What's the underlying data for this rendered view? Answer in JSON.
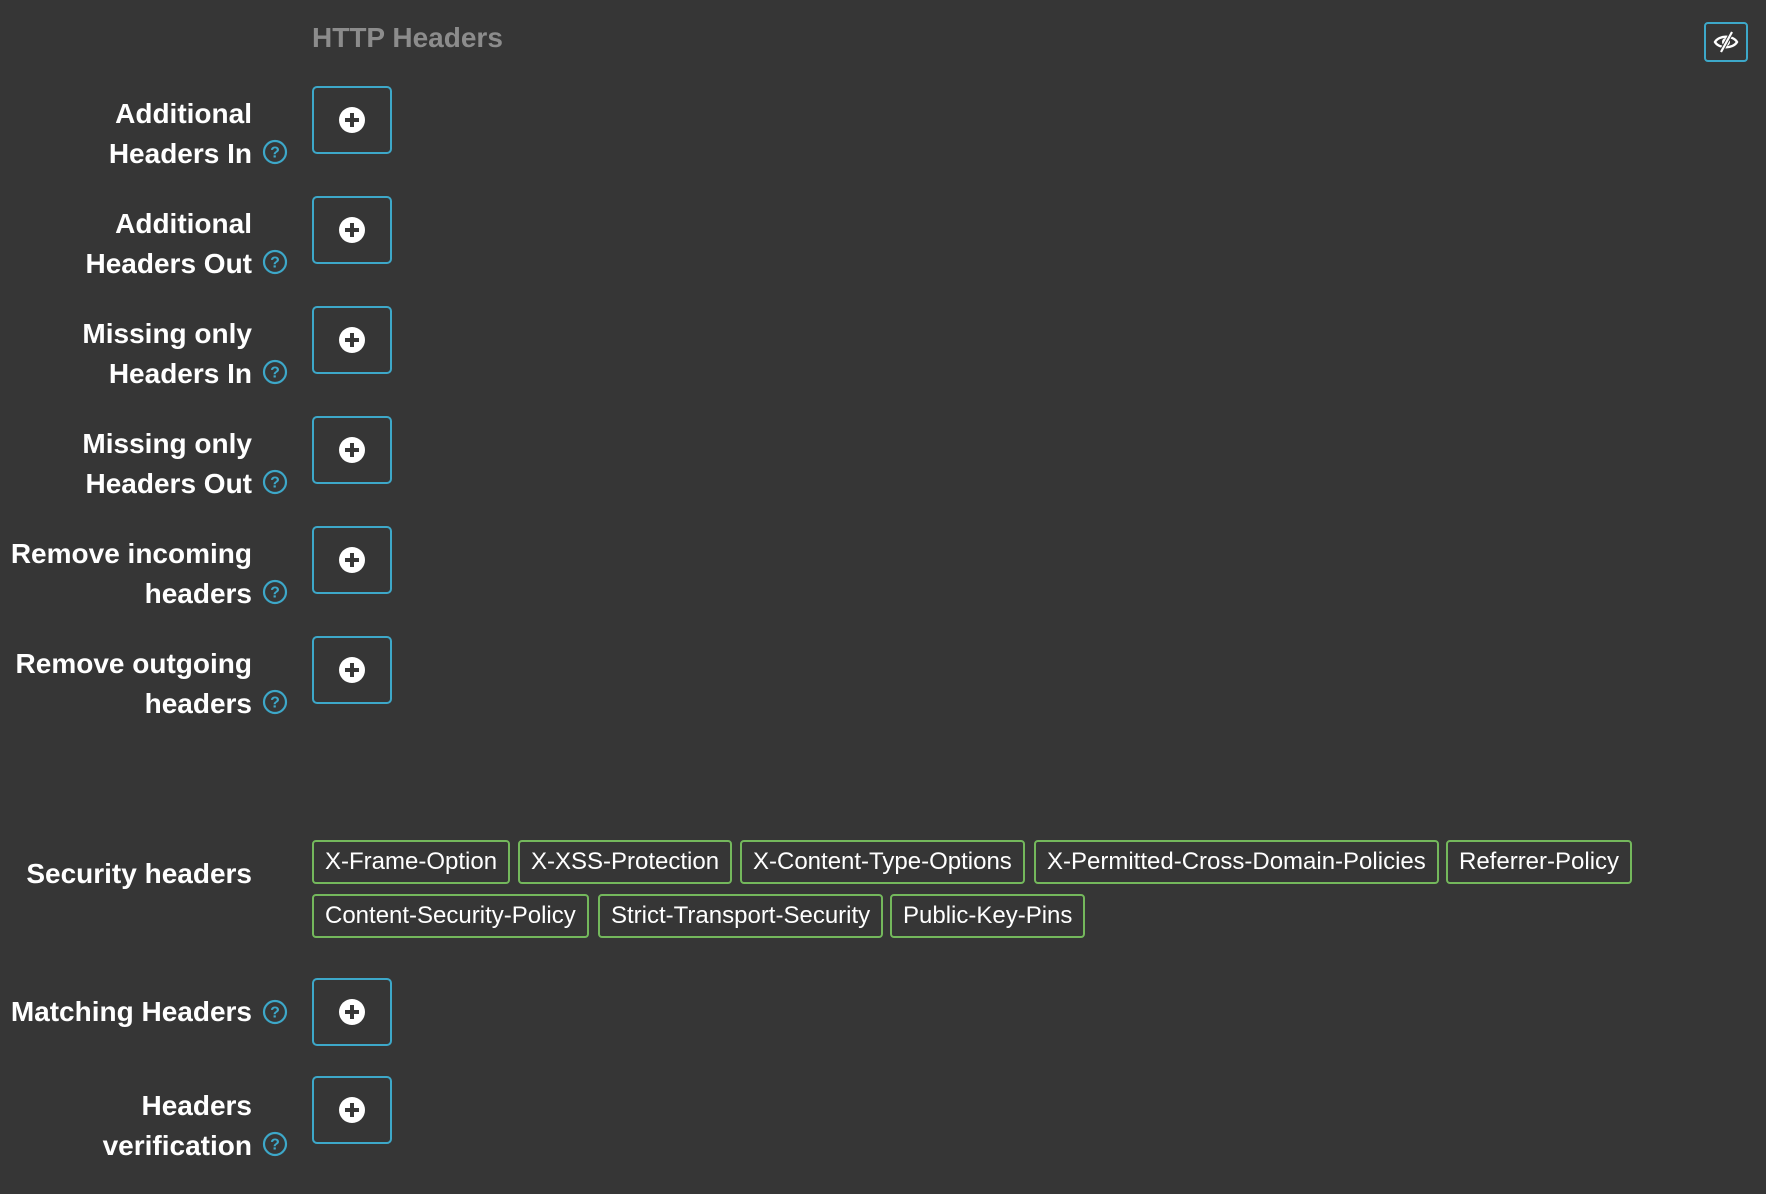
{
  "section": {
    "title": "HTTP Headers"
  },
  "toggle": {
    "icon": "eye-slash-icon",
    "color": "#3da8c9"
  },
  "fields": [
    {
      "line1": "Additional",
      "line2": "Headers In",
      "help": true
    },
    {
      "line1": "Additional",
      "line2": "Headers Out",
      "help": true
    },
    {
      "line1": "Missing only",
      "line2": "Headers In",
      "help": true
    },
    {
      "line1": "Missing only",
      "line2": "Headers Out",
      "help": true
    },
    {
      "line1": "Remove incoming",
      "line2": "headers",
      "help": true
    },
    {
      "line1": "Remove outgoing",
      "line2": "headers",
      "help": true
    }
  ],
  "security": {
    "label": "Security headers",
    "tags": [
      "X-Frame-Option",
      "X-XSS-Protection",
      "X-Content-Type-Options",
      "X-Permitted-Cross-Domain-Policies",
      "Referrer-Policy",
      "Content-Security-Policy",
      "Strict-Transport-Security",
      "Public-Key-Pins"
    ],
    "tag_color": "#74b85c"
  },
  "matching": {
    "label": "Matching Headers",
    "help": true
  },
  "verification": {
    "line1": "Headers",
    "line2": "verification",
    "help": true
  },
  "icons": {
    "add": "plus-circle-icon",
    "help": "question-circle-icon"
  },
  "colors": {
    "background": "#363636",
    "accent": "#3da8c9",
    "title": "#8c8c8c",
    "text": "#ffffff"
  }
}
